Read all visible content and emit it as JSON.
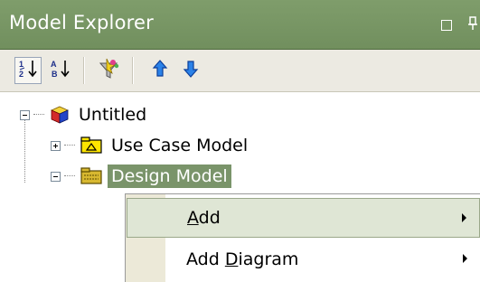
{
  "window": {
    "title": "Model Explorer",
    "buttons": {
      "maximize_icon": "window-restore-icon",
      "pin_icon": "pin-icon"
    }
  },
  "toolbar": {
    "items": [
      {
        "name": "sort-numeric-icon",
        "pressed": true
      },
      {
        "name": "sort-alpha-icon",
        "pressed": false
      },
      {
        "name": "filter-icon",
        "pressed": false
      },
      {
        "name": "move-up-icon",
        "pressed": false
      },
      {
        "name": "move-down-icon",
        "pressed": false
      }
    ]
  },
  "tree": {
    "root": {
      "label": "Untitled",
      "expanded": true,
      "icon": "project-cube-icon"
    },
    "children": [
      {
        "label": "Use Case Model",
        "expanded": false,
        "icon": "use-case-model-icon"
      },
      {
        "label": "Design Model",
        "expanded": true,
        "selected": true,
        "icon": "design-model-icon"
      }
    ]
  },
  "context_menu": {
    "items": [
      {
        "label_before": "",
        "mnemonic": "A",
        "label_after": "dd",
        "has_submenu": true,
        "highlighted": true
      },
      {
        "label_before": "Add ",
        "mnemonic": "D",
        "label_after": "iagram",
        "has_submenu": true,
        "highlighted": false
      }
    ]
  },
  "colors": {
    "titlebar": "#7f9d6b",
    "selection": "#7a946a",
    "toolbar": "#eceae2",
    "menu_highlight": "#dfe6d5"
  }
}
